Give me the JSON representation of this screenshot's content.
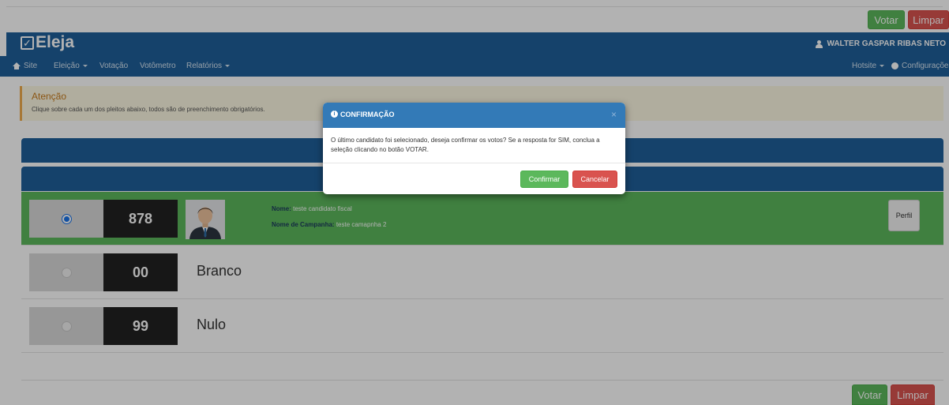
{
  "top_actions": {
    "vote_label": "Votar",
    "clear_label": "Limpar"
  },
  "brand": {
    "name": "Eleja"
  },
  "user": {
    "name": "WALTER GASPAR RIBAS NETO"
  },
  "nav": {
    "site": "Site",
    "eleicao": "Eleição",
    "votacao": "Votação",
    "votometro": "Votômetro",
    "relatorios": "Relatórios",
    "hotsite": "Hotsite",
    "configuracoes": "Configurações"
  },
  "alert": {
    "title": "Atenção",
    "text": "Clique sobre cada um dos pleitos abaixo, todos são de preenchimento obrigatórios."
  },
  "candidates": [
    {
      "number": "878",
      "selected": true,
      "name_label": "Nome:",
      "name": "teste candidato fiscal",
      "campaign_label": "Nome de Campanha:",
      "campaign_name": "teste camapnha 2",
      "profile_label": "Perfil"
    },
    {
      "number": "00",
      "label": "Branco",
      "selected": false
    },
    {
      "number": "99",
      "label": "Nulo",
      "selected": false
    }
  ],
  "modal": {
    "title": "CONFIRMAÇÃO",
    "close": "×",
    "message": "O último candidato foi selecionado, deseja confirmar os votos? Se a resposta for SIM, conclua a seleção clicando no botão VOTAR.",
    "confirm_label": "Confirmar",
    "cancel_label": "Cancelar"
  },
  "bottom_actions": {
    "vote_label": "Votar",
    "clear_label": "Limpar"
  },
  "colors": {
    "primary_blue": "#1f5f9a",
    "modal_header": "#337ab7",
    "success": "#5cb85c",
    "danger": "#d9534f",
    "warning_border": "#f0ad4e"
  }
}
